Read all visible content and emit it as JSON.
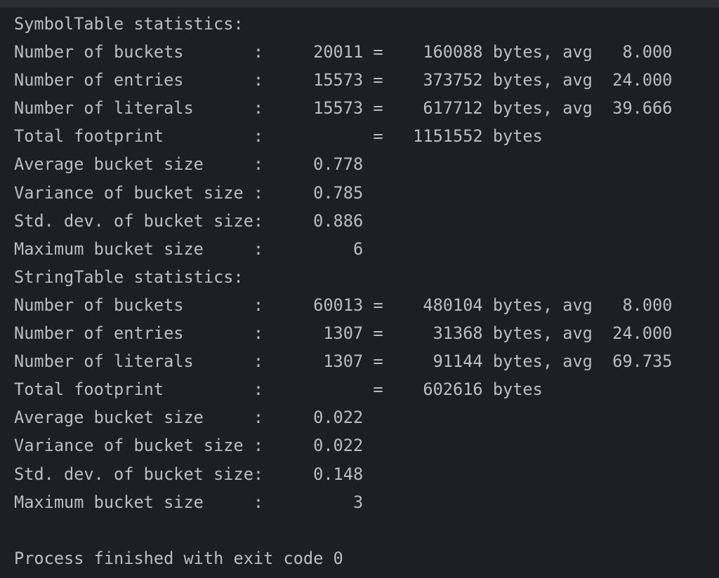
{
  "console": {
    "lines": [
      "SymbolTable statistics:",
      "Number of buckets       :     20011 =    160088 bytes, avg   8.000",
      "Number of entries       :     15573 =    373752 bytes, avg  24.000",
      "Number of literals      :     15573 =    617712 bytes, avg  39.666",
      "Total footprint         :           =   1151552 bytes",
      "Average bucket size     :     0.778",
      "Variance of bucket size :     0.785",
      "Std. dev. of bucket size:     0.886",
      "Maximum bucket size     :         6",
      "StringTable statistics:",
      "Number of buckets       :     60013 =    480104 bytes, avg   8.000",
      "Number of entries       :      1307 =     31368 bytes, avg  24.000",
      "Number of literals      :      1307 =     91144 bytes, avg  69.735",
      "Total footprint         :           =    602616 bytes",
      "Average bucket size     :     0.022",
      "Variance of bucket size :     0.022",
      "Std. dev. of bucket size:     0.148",
      "Maximum bucket size     :         3",
      "",
      "Process finished with exit code 0"
    ]
  }
}
